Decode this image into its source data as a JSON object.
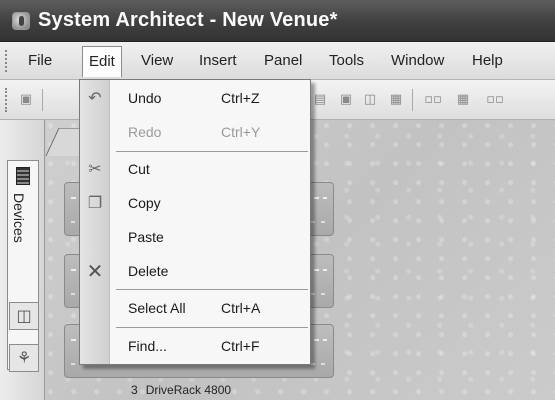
{
  "window": {
    "title": "System Architect - New Venue*"
  },
  "menubar": {
    "items": [
      {
        "label": "File"
      },
      {
        "label": "Edit",
        "active": true
      },
      {
        "label": "View"
      },
      {
        "label": "Insert"
      },
      {
        "label": "Panel"
      },
      {
        "label": "Tools"
      },
      {
        "label": "Window"
      },
      {
        "label": "Help"
      }
    ]
  },
  "edit_menu": {
    "undo": {
      "label": "Undo",
      "shortcut": "Ctrl+Z",
      "icon": "undo-icon"
    },
    "redo": {
      "label": "Redo",
      "shortcut": "Ctrl+Y",
      "enabled": false
    },
    "cut": {
      "label": "Cut",
      "icon": "scissors-icon"
    },
    "copy": {
      "label": "Copy",
      "icon": "copy-icon"
    },
    "paste": {
      "label": "Paste"
    },
    "delete": {
      "label": "Delete",
      "icon": "delete-x-icon"
    },
    "select_all": {
      "label": "Select All",
      "shortcut": "Ctrl+A"
    },
    "find": {
      "label": "Find...",
      "shortcut": "Ctrl+F"
    }
  },
  "leftdock": {
    "devices_tab": "Devices"
  },
  "canvas": {
    "device_caption": {
      "number": "3",
      "name": "DriveRack 4800"
    }
  },
  "colors": {
    "titlebar": "#3f3f3f",
    "menu_background": "#f7f7f7",
    "canvas": "#c9c9c9"
  }
}
